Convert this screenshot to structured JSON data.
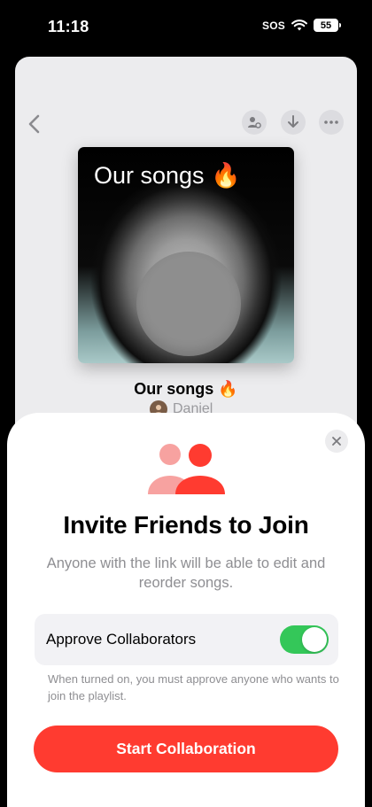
{
  "status_bar": {
    "time": "11:18",
    "sos": "SOS",
    "battery": "55"
  },
  "playlist": {
    "artwork_title": "Our songs 🔥",
    "title": "Our songs 🔥",
    "owner": "Daniel"
  },
  "sheet": {
    "title": "Invite Friends to Join",
    "description": "Anyone with the link will be able to edit and reorder songs.",
    "toggle_label": "Approve Collaborators",
    "toggle_on": true,
    "toggle_note": "When turned on, you must approve anyone who wants to join the playlist.",
    "start_button": "Start Collaboration"
  },
  "colors": {
    "accent": "#ff3b30",
    "toggle_on": "#34c759",
    "invite_light": "#f7a2a0",
    "invite_dark": "#ff3b30"
  },
  "icons": [
    "back-icon",
    "add-person-icon",
    "download-icon",
    "more-icon",
    "close-icon",
    "invite-friends-icon",
    "wifi-icon",
    "battery-icon"
  ]
}
